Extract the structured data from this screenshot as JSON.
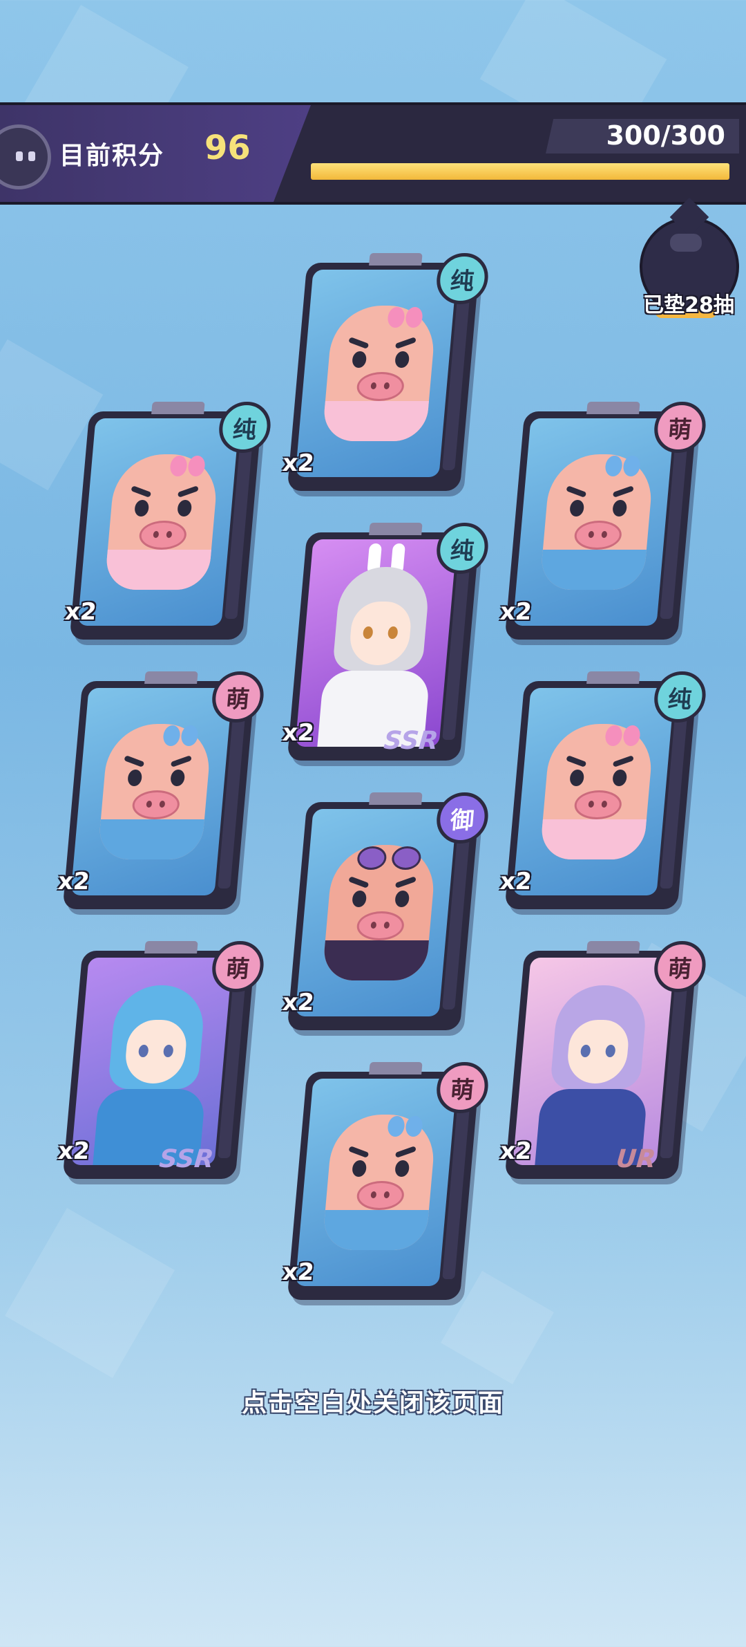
{
  "header": {
    "score_label": "目前积分",
    "score_value": "96",
    "progress_text": "300/300",
    "progress_fraction": 1.0
  },
  "pity_badge": {
    "text": "已垫28抽"
  },
  "cards": [
    {
      "id": "c1",
      "kind": "pig",
      "variant": "pink",
      "tag": "纯",
      "tag_type": "pure",
      "count": "x2",
      "rarity": ""
    },
    {
      "id": "c2",
      "kind": "pig",
      "variant": "pink",
      "tag": "纯",
      "tag_type": "pure",
      "count": "x2",
      "rarity": ""
    },
    {
      "id": "c3",
      "kind": "pig",
      "variant": "blue",
      "tag": "萌",
      "tag_type": "cute",
      "count": "x2",
      "rarity": ""
    },
    {
      "id": "c4",
      "kind": "girl",
      "variant": "silver",
      "tag": "纯",
      "tag_type": "pure",
      "count": "x2",
      "rarity": "SSR"
    },
    {
      "id": "c5",
      "kind": "pig",
      "variant": "blue",
      "tag": "萌",
      "tag_type": "cute",
      "count": "x2",
      "rarity": ""
    },
    {
      "id": "c6",
      "kind": "pig",
      "variant": "pink",
      "tag": "纯",
      "tag_type": "pure",
      "count": "x2",
      "rarity": ""
    },
    {
      "id": "c7",
      "kind": "pig",
      "variant": "dark",
      "tag": "御",
      "tag_type": "royal",
      "count": "x2",
      "rarity": ""
    },
    {
      "id": "c8",
      "kind": "girl",
      "variant": "blue",
      "tag": "萌",
      "tag_type": "cute",
      "count": "x2",
      "rarity": "SSR"
    },
    {
      "id": "c9",
      "kind": "girl",
      "variant": "lavender",
      "tag": "萌",
      "tag_type": "cute",
      "count": "x2",
      "rarity": "UR"
    },
    {
      "id": "c10",
      "kind": "pig",
      "variant": "blue",
      "tag": "萌",
      "tag_type": "cute",
      "count": "x2",
      "rarity": ""
    }
  ],
  "footer": {
    "hint": "点击空白处关闭该页面"
  },
  "colors": {
    "bar_fill": "#f2b83a",
    "tag_pure": "#6fd3dd",
    "tag_cute": "#ef9bc0",
    "tag_royal": "#8a6ee6"
  }
}
